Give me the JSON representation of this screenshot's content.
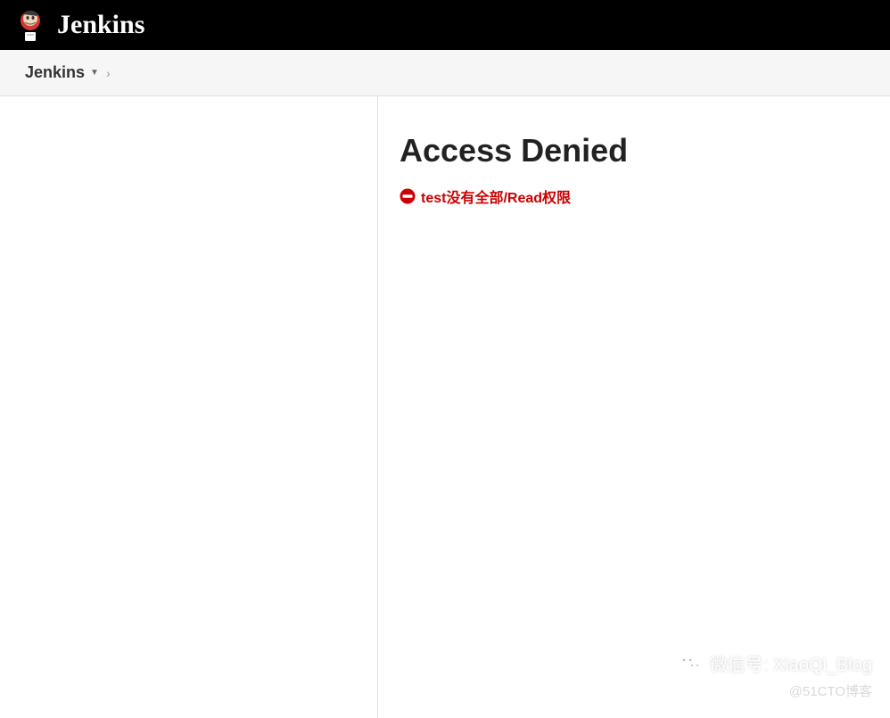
{
  "header": {
    "brand": "Jenkins"
  },
  "breadcrumb": {
    "item": "Jenkins"
  },
  "main": {
    "title": "Access Denied",
    "error_message": "test没有全部/Read权限"
  },
  "watermark": {
    "line1": "微信号: XiaoQi_Blog",
    "line2": "@51CTO博客"
  }
}
